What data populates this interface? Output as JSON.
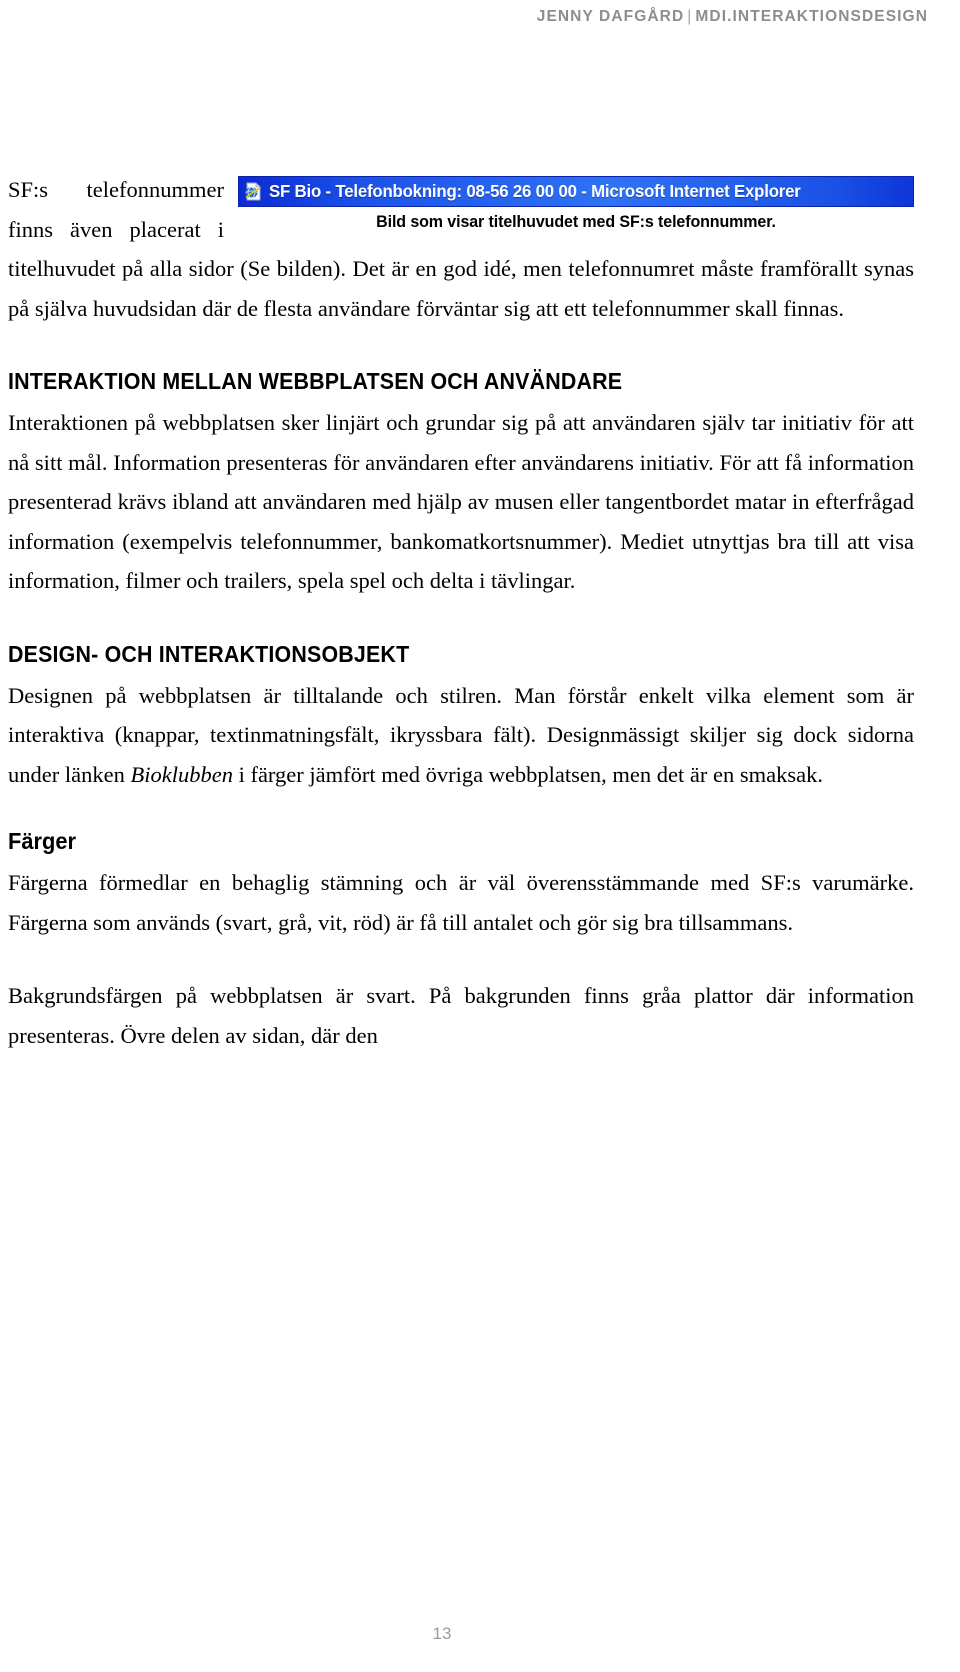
{
  "header": {
    "author": "JENNY DAFGÅRD",
    "separator": "|",
    "course": "MDI.INTERAKTIONSDESIGN"
  },
  "figure": {
    "icon": "internet-explorer-icon",
    "titlebar_text": "SF Bio - Telefonbokning: 08-56 26 00 00 - Microsoft Internet Explorer",
    "caption": "Bild som visar titelhuvudet med SF:s telefonnummer.",
    "titlebar_color": "#1c52e8",
    "titlebar_text_color": "#ffffff"
  },
  "body": {
    "intro_paragraph": "SF:s telefonnummer finns även placerat i titelhuvudet på alla sidor (Se bilden). Det är en god idé, men telefonnumret måste framförallt synas på själva huvudsidan där de flesta användare förväntar sig att ett telefonnummer skall finnas."
  },
  "sections": [
    {
      "heading": "INTERAKTION MELLAN WEBBPLATSEN OCH ANVÄNDARE",
      "paragraph": "Interaktionen på webbplatsen sker linjärt och grundar sig på att användaren själv tar initiativ för att nå sitt mål. Information presenteras för användaren efter användarens initiativ. För att få information presenterad krävs ibland att användaren med hjälp av musen eller tangentbordet matar in efterfrågad information (exempelvis telefonnummer, bankomatkortsnummer). Mediet utnyttjas bra till att visa information, filmer och trailers, spela spel och delta i tävlingar."
    },
    {
      "heading": "DESIGN- OCH INTERAKTIONSOBJEKT",
      "paragraph_part1": "Designen på webbplatsen är tilltalande och stilren. Man förstår enkelt vilka element som är interaktiva (knappar, textinmatningsfält, ikryssbara fält). Designmässigt skiljer sig dock sidorna under länken ",
      "emphasis": "Bioklubben",
      "paragraph_part2": " i färger jämfört med övriga webbplatsen, men det är en smaksak.",
      "subsection": {
        "heading": "Färger",
        "paragraph1": "Färgerna förmedlar en behaglig stämning och är väl överensstämmande med SF:s varumärke. Färgerna som används (svart, grå, vit, röd) är få till antalet och gör sig bra tillsammans.",
        "paragraph2": "Bakgrundsfärgen på webbplatsen är svart. På bakgrunden finns gråa plattor där information presenteras. Övre delen av sidan, där den"
      }
    }
  ],
  "footer": {
    "page_number": "13"
  }
}
